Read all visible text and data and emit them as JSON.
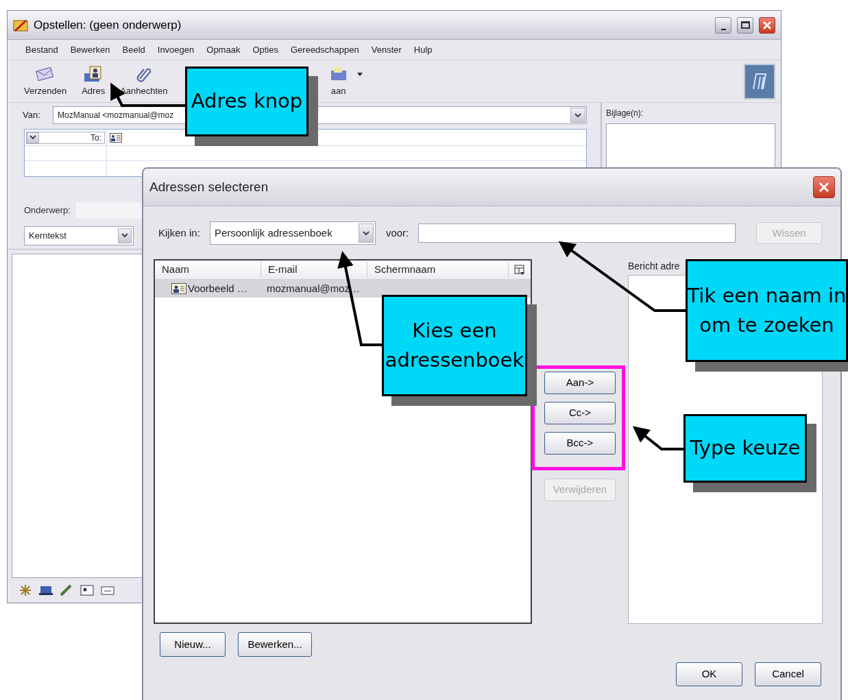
{
  "compose_window": {
    "title": "Opstellen: (geen onderwerp)",
    "menu": [
      "Bestand",
      "Bewerken",
      "Beeld",
      "Invoegen",
      "Opmaak",
      "Opties",
      "Gereedschappen",
      "Venster",
      "Hulp"
    ],
    "toolbar": [
      {
        "kind": "send",
        "label": "Verzenden"
      },
      {
        "kind": "address",
        "label": "Adres"
      },
      {
        "kind": "attach",
        "label": "Aanhechten"
      },
      {
        "kind": "save",
        "label": "aan"
      }
    ],
    "from_label": "Van:",
    "from_value": "MozManual <mozmanual@moz",
    "recipient_type": "To:",
    "attachments_label": "Bijlage(n):",
    "subject_label": "Onderwerp:",
    "format": "Kerntekst"
  },
  "dialog": {
    "title": "Adressen selecteren",
    "look_in_label": "Kijken in:",
    "look_in_value": "Persoonlijk adressenboek",
    "search_label": "voor:",
    "clear_button": {
      "label": "Wissen",
      "disabled": true
    },
    "columns": [
      "Naam",
      "E-mail",
      "Schermnaam"
    ],
    "rows": [
      {
        "name": "Voorbeeld …",
        "email": "mozmanual@moz…",
        "selected": true
      }
    ],
    "type_buttons": [
      {
        "label": "Aan->"
      },
      {
        "label": "Cc->"
      },
      {
        "label": "Bcc->"
      }
    ],
    "remove_button": {
      "label": "Verwijderen",
      "disabled": true
    },
    "recipients_label": "Bericht adre",
    "bottom_buttons": [
      "Nieuw...",
      "Bewerken..."
    ],
    "ok": "OK",
    "cancel": "Cancel"
  },
  "callouts": [
    {
      "lines": [
        "Adres knop"
      ]
    },
    {
      "lines": [
        "Kies een",
        "adressenboek"
      ]
    },
    {
      "lines": [
        "Tik een naam in",
        "om te zoeken"
      ]
    },
    {
      "lines": [
        "Type keuze"
      ]
    }
  ]
}
